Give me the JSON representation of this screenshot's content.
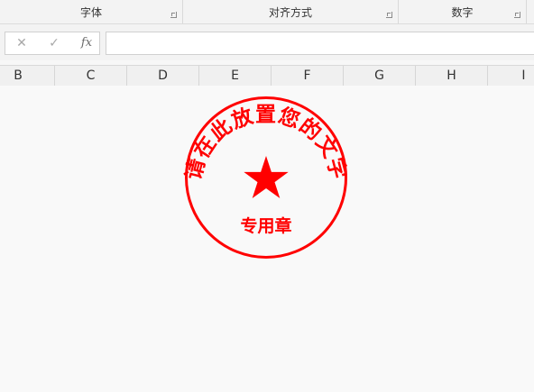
{
  "ribbon": {
    "groups": [
      {
        "label": "字体"
      },
      {
        "label": "对齐方式"
      },
      {
        "label": "数字"
      }
    ]
  },
  "formula_bar": {
    "cancel_icon": "close-icon",
    "confirm_icon": "check-icon",
    "fx_label": "fx",
    "value": ""
  },
  "columns": [
    "B",
    "C",
    "D",
    "E",
    "F",
    "G",
    "H",
    "I"
  ],
  "stamp": {
    "arc_text": "请在此放置您的文字",
    "bottom_text": "专用章",
    "color": "#ff0000",
    "center_icon": "star-icon"
  }
}
